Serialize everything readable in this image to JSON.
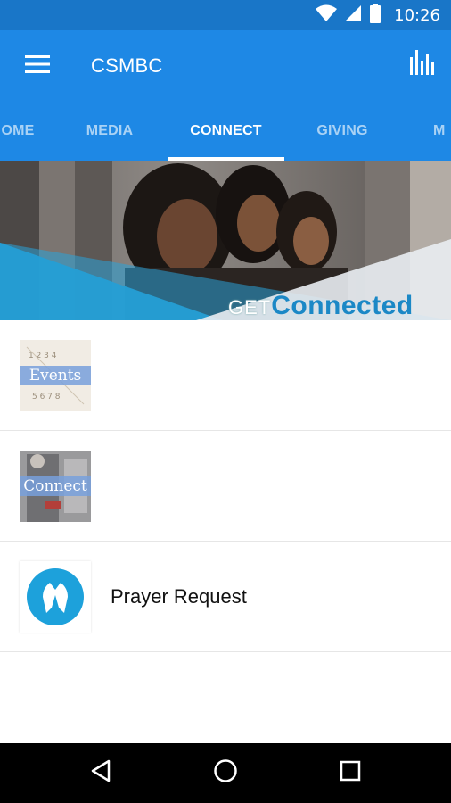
{
  "status_bar": {
    "time": "10:26",
    "icons": [
      "wifi-icon",
      "signal-icon",
      "battery-icon"
    ]
  },
  "app_bar": {
    "title": "CSMBC",
    "menu_icon": "menu-icon",
    "stats_icon": "bar-chart-icon"
  },
  "tabs": [
    {
      "label": "HOME",
      "shown": "OME",
      "active": false
    },
    {
      "label": "MEDIA",
      "shown": "MEDIA",
      "active": false
    },
    {
      "label": "CONNECT",
      "shown": "CONNECT",
      "active": true
    },
    {
      "label": "GIVING",
      "shown": "GIVING",
      "active": false
    },
    {
      "label": "M",
      "shown": "M",
      "active": false
    }
  ],
  "banner": {
    "text_prefix": "GET",
    "text_main": "Connected"
  },
  "list": [
    {
      "label": "",
      "thumb_caption": "Events",
      "thumb_icon": "events-thumbnail"
    },
    {
      "label": "",
      "thumb_caption": "Connect",
      "thumb_icon": "connect-thumbnail"
    },
    {
      "label": "Prayer Request",
      "thumb_caption": "",
      "thumb_icon": "praying-hands-icon"
    }
  ],
  "colors": {
    "status_bar": "#1976c8",
    "app_bar": "#1e88e5",
    "accent": "#29a3d9"
  },
  "nav_bar": {
    "icons": [
      "back-icon",
      "home-icon",
      "recents-icon"
    ]
  }
}
